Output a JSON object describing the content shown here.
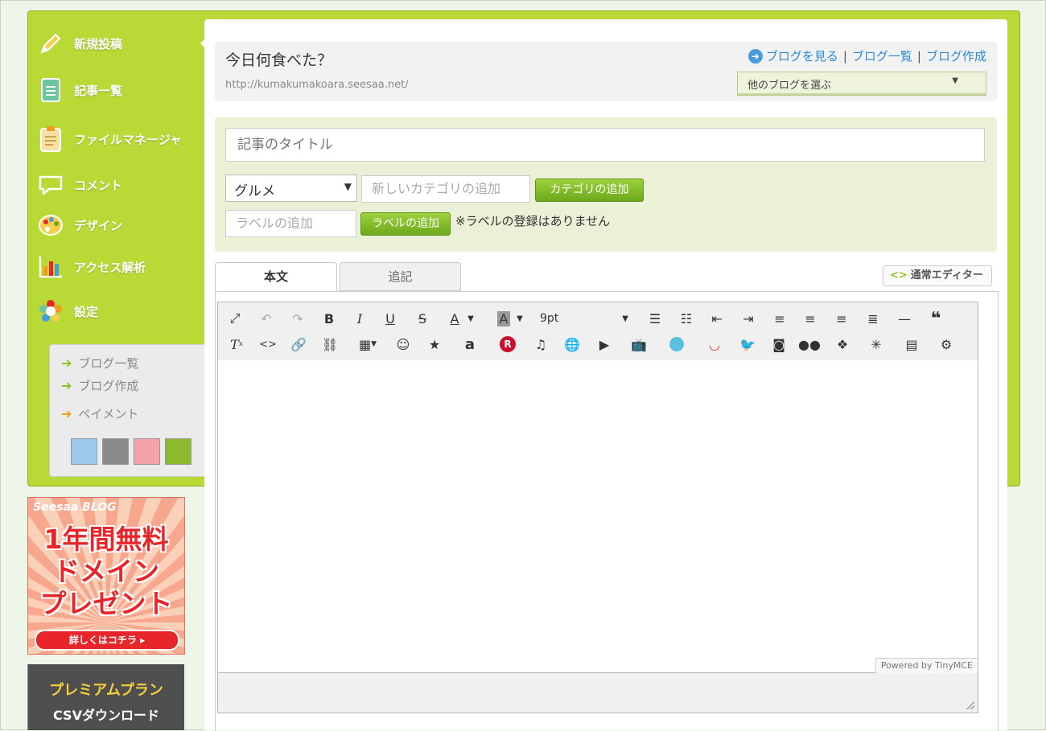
{
  "nav": {
    "items": [
      {
        "label": "新規投稿",
        "icon": "pencil-icon"
      },
      {
        "label": "記事一覧",
        "icon": "document-icon"
      },
      {
        "label": "ファイルマネージャ",
        "icon": "clipboard-icon"
      },
      {
        "label": "コメント",
        "icon": "speech-bubble-icon"
      },
      {
        "label": "デザイン",
        "icon": "palette-icon"
      },
      {
        "label": "アクセス解析",
        "icon": "bar-chart-icon"
      },
      {
        "label": "設定",
        "icon": "gear-flower-icon"
      }
    ],
    "sub_links": [
      "ブログ一覧",
      "ブログ作成",
      "ペイメント"
    ],
    "swatches": [
      "#9cc9ee",
      "#8a8a8a",
      "#f4a3a8",
      "#8cb92d"
    ]
  },
  "ads": {
    "ad1": {
      "brand": "Seesaa BLOG",
      "line1": "1年間無料",
      "line2": "ドメイン",
      "line3": "プレゼント",
      "button": "詳しくはコチラ ▸"
    },
    "ad2": {
      "line1": "プレミアムプラン",
      "line2": "CSVダウンロード"
    }
  },
  "blog": {
    "title": "今日何食べた？",
    "url": "http://kumakumakoara.seesaa.net/",
    "links": [
      "ブログを見る",
      "ブログ一覧",
      "ブログ作成"
    ],
    "select_label": "他のブログを選ぶ"
  },
  "form": {
    "title_placeholder": "記事のタイトル",
    "category_selected": "グルメ",
    "new_category_placeholder": "新しいカテゴリの追加",
    "add_category_button": "カテゴリの追加",
    "label_placeholder": "ラベルの追加",
    "add_label_button": "ラベルの追加",
    "label_note": "※ラベルの登録はありません"
  },
  "tabs": [
    "本文",
    "追記"
  ],
  "editor_switch": "通常エディター",
  "editor": {
    "font_size": "9pt",
    "powered_by": "Powered by TinyMCE"
  },
  "colors": {
    "accent_green": "#b9d936",
    "link_blue": "#2a8ad4"
  }
}
